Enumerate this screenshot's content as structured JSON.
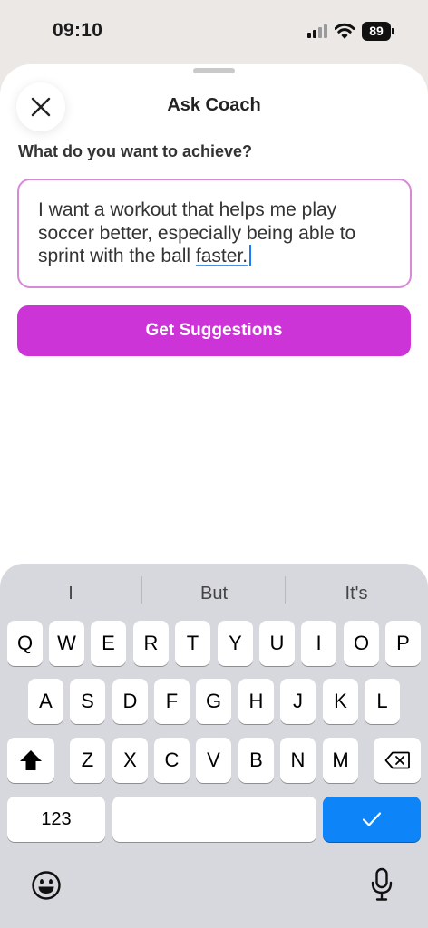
{
  "status_bar": {
    "time": "09:10",
    "battery": "89"
  },
  "sheet": {
    "title": "Ask Coach",
    "prompt_label": "What do you want to achieve?",
    "input_value_main": "I want a workout that helps me play soccer better, especially being able to sprint with the ball ",
    "input_value_underlined": "faster.",
    "submit_label": "Get Suggestions"
  },
  "keyboard": {
    "suggestions": [
      "I",
      "But",
      "It's"
    ],
    "row1": [
      "Q",
      "W",
      "E",
      "R",
      "T",
      "Y",
      "U",
      "I",
      "O",
      "P"
    ],
    "row2": [
      "A",
      "S",
      "D",
      "F",
      "G",
      "H",
      "J",
      "K",
      "L"
    ],
    "row3": [
      "Z",
      "X",
      "C",
      "V",
      "B",
      "N",
      "M"
    ],
    "numbers_label": "123"
  },
  "colors": {
    "accent": "#cc34d7",
    "field_border": "#d58ad8",
    "done_key": "#0d84f7"
  },
  "icons": [
    "close-icon",
    "shift-icon",
    "backspace-icon",
    "checkmark-icon",
    "emoji-icon",
    "microphone-icon",
    "signal-icon",
    "wifi-icon"
  ]
}
